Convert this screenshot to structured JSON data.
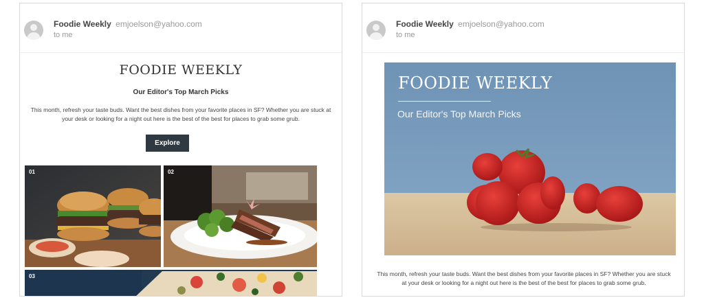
{
  "emails": [
    {
      "sender_name": "Foodie Weekly",
      "sender_email": "emjoelson@yahoo.com",
      "recipient": "to me",
      "brand_title": "FOODIE WEEKLY",
      "subheading": "Our Editor's Top March Picks",
      "intro": "This month, refresh your taste buds. Want the best dishes from your favorite places in SF? Whether you are stuck at your desk or looking for a night out here is the best of the best for places to grab some grub.",
      "cta_label": "Explore",
      "tiles": [
        {
          "number": "01",
          "image": "burgers-photo"
        },
        {
          "number": "02",
          "image": "steak-broccoli-plate-photo"
        },
        {
          "number": "03",
          "image": "pizza-photo"
        }
      ]
    },
    {
      "sender_name": "Foodie Weekly",
      "sender_email": "emjoelson@yahoo.com",
      "recipient": "to me",
      "hero_title": "FOODIE WEEKLY",
      "hero_subtitle": "Our Editor's Top March Picks",
      "hero_image": "strawberries-photo",
      "intro": "This month, refresh your taste buds. Want the best dishes from your favorite places in SF? Whether you are stuck at your desk or looking for a night out here is the best of the best for places to grab some grub."
    }
  ],
  "colors": {
    "button_bg": "#2f3941",
    "hero_sky": "#6f93b5",
    "text_muted": "#9a9a9a"
  }
}
